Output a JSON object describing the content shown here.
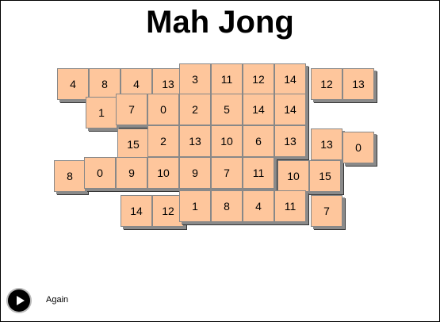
{
  "title": "Mah Jong",
  "again_label": "Again",
  "tile_color": "#fec69c",
  "tiles": [
    "4",
    "8",
    "4",
    "13",
    "3",
    "11",
    "12",
    "14",
    "12",
    "13",
    "1",
    "7",
    "0",
    "2",
    "5",
    "14",
    "14",
    "15",
    "2",
    "13",
    "10",
    "6",
    "13",
    "13",
    "0",
    "8",
    "0",
    "9",
    "10",
    "9",
    "7",
    "11",
    "10",
    "15",
    "14",
    "12",
    "1",
    "8",
    "4",
    "11",
    "7"
  ]
}
